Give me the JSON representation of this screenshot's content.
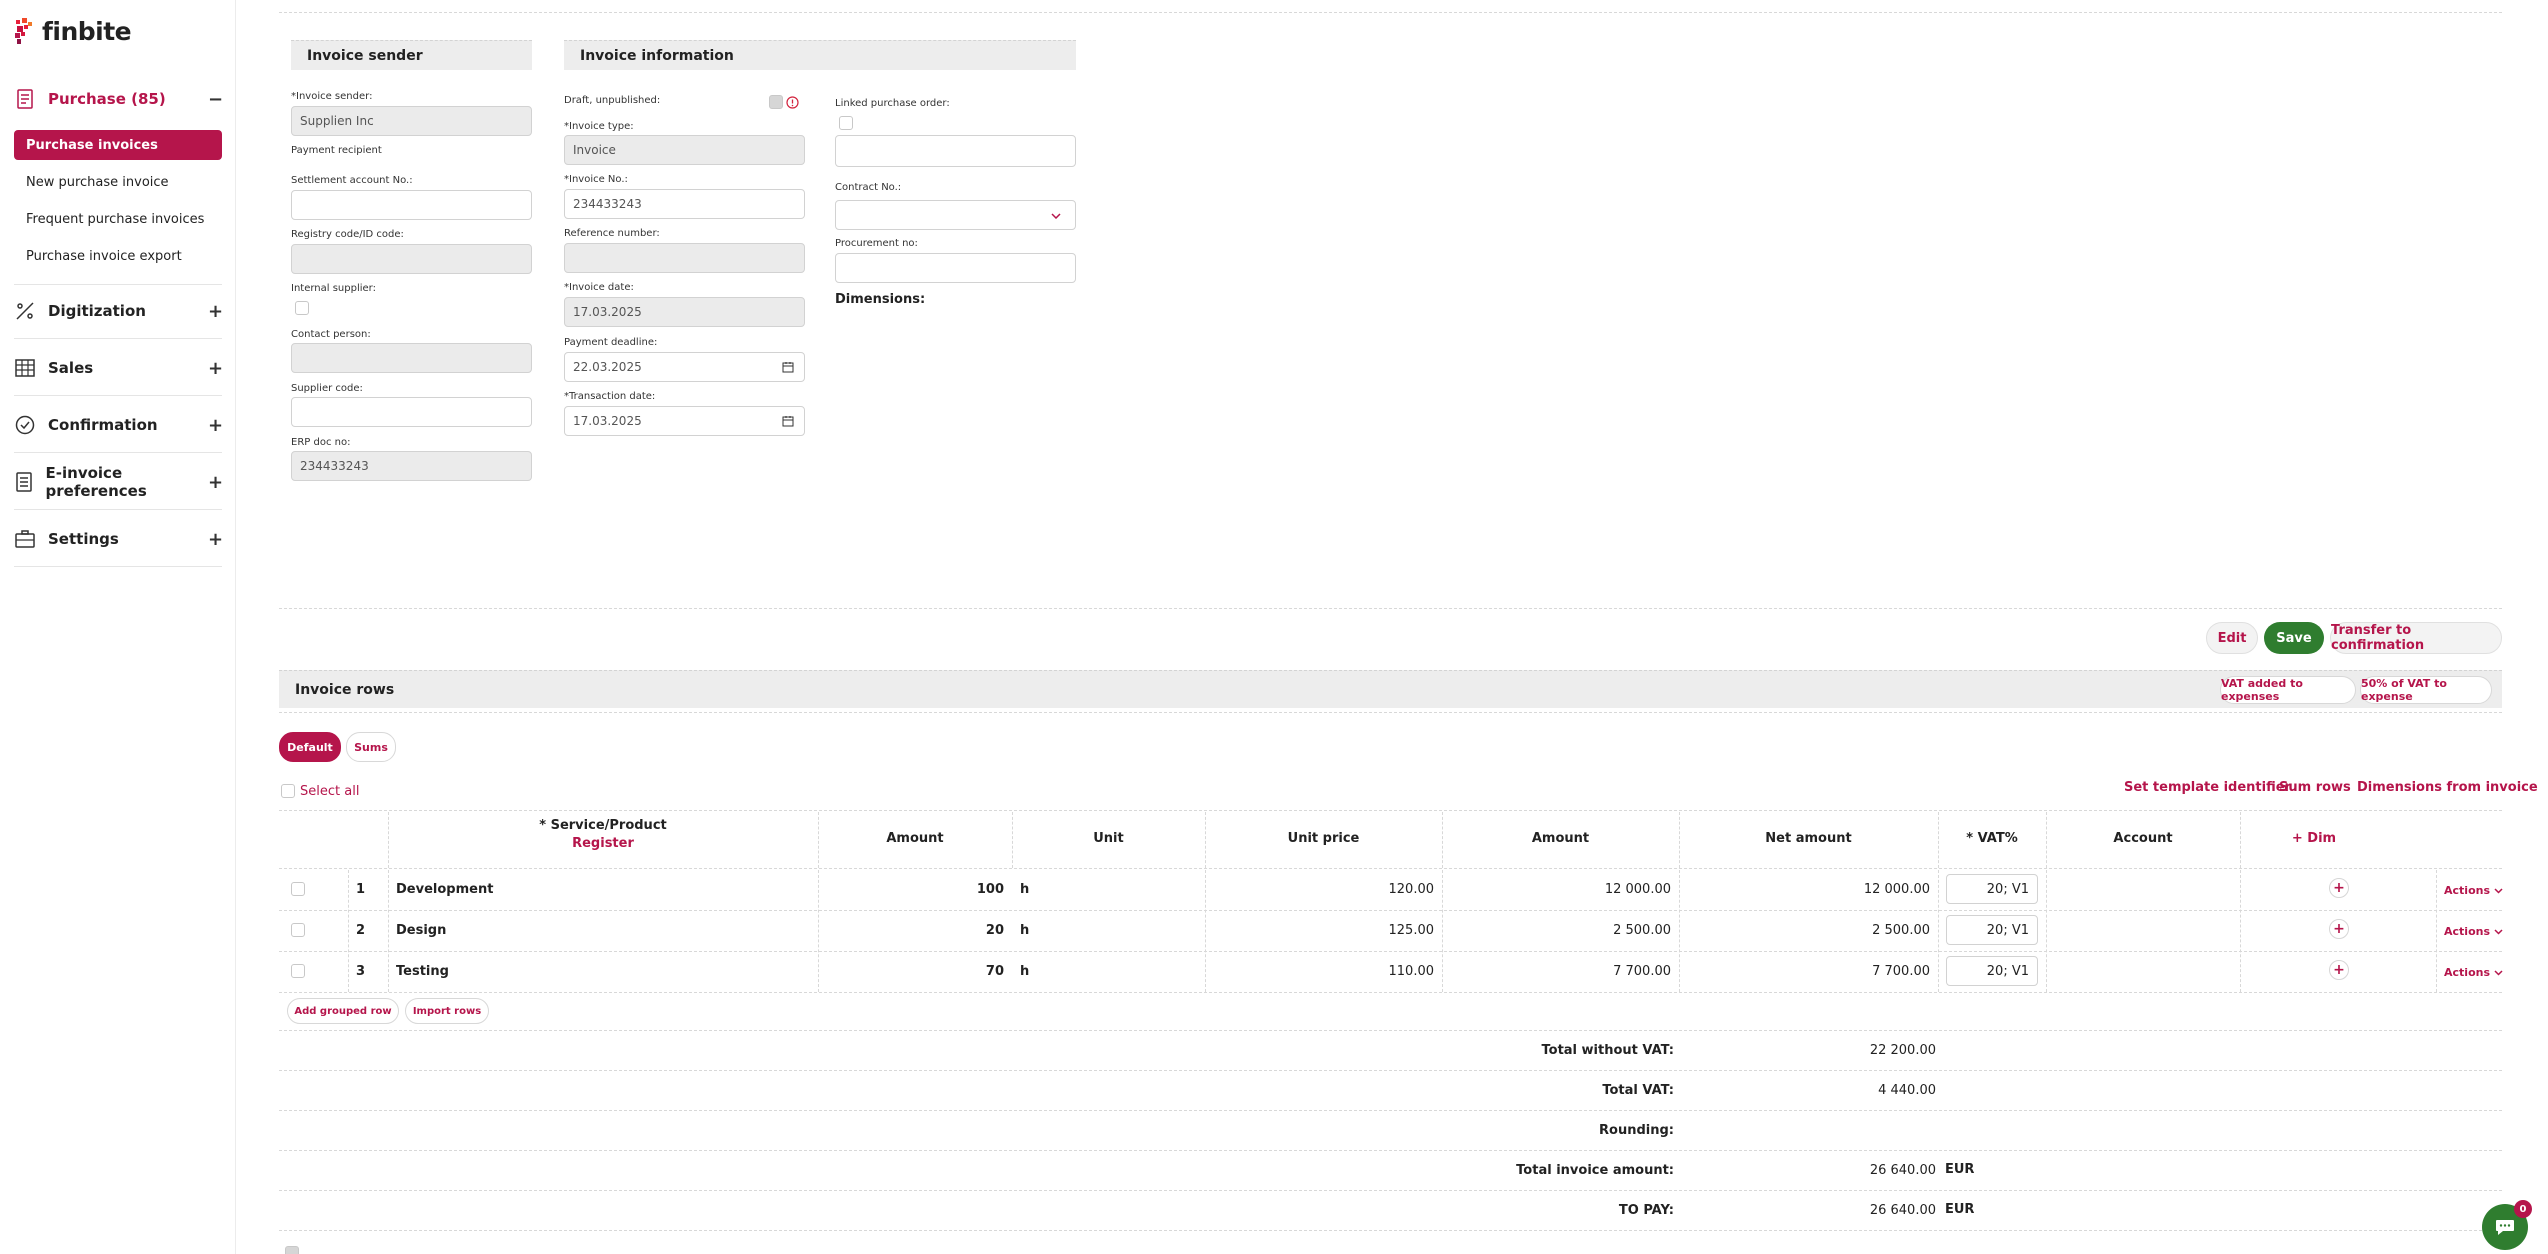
{
  "brand": {
    "name": "finbite"
  },
  "sidebar": {
    "purchase": {
      "label": "Purchase (85)",
      "toggle": "−"
    },
    "sub_items": [
      {
        "label": "Purchase invoices"
      },
      {
        "label": "New purchase invoice"
      },
      {
        "label": "Frequent purchase invoices"
      },
      {
        "label": "Purchase invoice export"
      }
    ],
    "sections": [
      {
        "label": "Digitization",
        "toggle": "+"
      },
      {
        "label": "Sales",
        "toggle": "+"
      },
      {
        "label": "Confirmation",
        "toggle": "+"
      },
      {
        "label": "E-invoice preferences",
        "toggle": "+"
      },
      {
        "label": "Settings",
        "toggle": "+"
      }
    ]
  },
  "sender": {
    "title": "Invoice sender",
    "invoice_sender_label": "*Invoice sender:",
    "invoice_sender_value": "Supplien Inc",
    "payment_recipient_label": "Payment recipient",
    "settlement_label": "Settlement account No.:",
    "registry_label": "Registry code/ID code:",
    "internal_label": "Internal supplier:",
    "contact_label": "Contact person:",
    "supplier_code_label": "Supplier code:",
    "erp_label": "ERP doc no:",
    "erp_value": "234433243"
  },
  "info": {
    "title": "Invoice information",
    "draft_label": "Draft, unpublished:",
    "type_label": "*Invoice type:",
    "type_value": "Invoice",
    "no_label": "*Invoice No.:",
    "no_value": "234433243",
    "ref_label": "Reference number:",
    "date_label": "*Invoice date:",
    "date_value": "17.03.2025",
    "deadline_label": "Payment deadline:",
    "deadline_value": "22.03.2025",
    "transaction_label": "*Transaction date:",
    "transaction_value": "17.03.2025",
    "linked_po_label": "Linked purchase order:",
    "contract_label": "Contract No.:",
    "procurement_label": "Procurement no:",
    "dimensions_label": "Dimensions:"
  },
  "toolbar": {
    "edit": "Edit",
    "save": "Save",
    "transfer": "Transfer to confirmation"
  },
  "rows_panel": {
    "title": "Invoice rows",
    "vat_expenses": "VAT added to expenses",
    "vat_50": "50% of VAT to expense",
    "tab_default": "Default",
    "tab_sums": "Sums",
    "select_all": "Select all",
    "set_template": "Set template identifier",
    "sum_rows": "Sum rows",
    "dims_from_invoice": "Dimensions from invoice"
  },
  "table": {
    "headers": {
      "service": "* Service/Product",
      "register": "Register",
      "amount": "Amount",
      "unit": "Unit",
      "unit_price": "Unit price",
      "amount2": "Amount",
      "net_amount": "Net amount",
      "vat": "* VAT%",
      "account": "Account",
      "dim": "+ Dim"
    },
    "rows": [
      {
        "n": "1",
        "service": "Development",
        "qty": "100",
        "unit": "h",
        "unit_price": "120.00",
        "amount": "12 000.00",
        "net": "12 000.00",
        "vat": "20; V1",
        "actions": "Actions"
      },
      {
        "n": "2",
        "service": "Design",
        "qty": "20",
        "unit": "h",
        "unit_price": "125.00",
        "amount": "2 500.00",
        "net": "2 500.00",
        "vat": "20; V1",
        "actions": "Actions"
      },
      {
        "n": "3",
        "service": "Testing",
        "qty": "70",
        "unit": "h",
        "unit_price": "110.00",
        "amount": "7 700.00",
        "net": "7 700.00",
        "vat": "20; V1",
        "actions": "Actions"
      }
    ],
    "add_grouped": "Add grouped row",
    "import_rows": "Import rows"
  },
  "totals": {
    "without_vat_label": "Total without VAT:",
    "without_vat": "22 200.00",
    "vat_label": "Total VAT:",
    "vat": "4 440.00",
    "rounding_label": "Rounding:",
    "total_label": "Total invoice amount:",
    "total": "26 640.00",
    "total_currency": "EUR",
    "to_pay_label": "TO PAY:",
    "to_pay": "26 640.00",
    "to_pay_currency": "EUR"
  },
  "chat": {
    "badge": "0"
  }
}
